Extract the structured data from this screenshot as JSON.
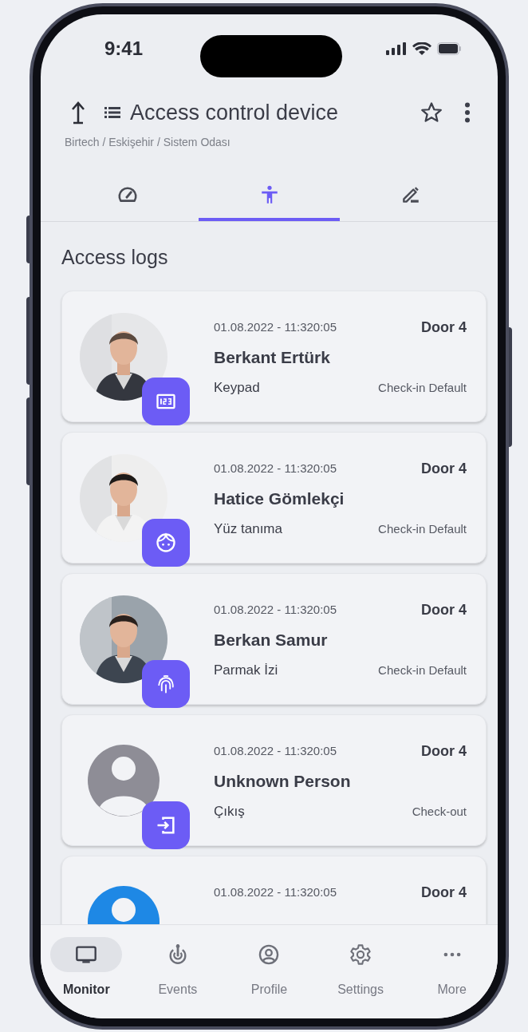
{
  "status_bar": {
    "time": "9:41"
  },
  "header": {
    "title": "Access control device",
    "breadcrumb": "Birtech / Eskişehir / Sistem Odası"
  },
  "tabs": [
    {
      "kind": "gauge",
      "selected": false
    },
    {
      "kind": "person",
      "selected": true
    },
    {
      "kind": "edit",
      "selected": false
    }
  ],
  "section_title": "Access logs",
  "logs": [
    {
      "badge": {
        "kind": "keypad"
      },
      "datetime": "01.08.2022 - 11:320:05",
      "door": "Door 4",
      "name": "Berkant Ertürk",
      "method": "Keypad",
      "type": "Check-in Default"
    },
    {
      "badge": {
        "kind": "face"
      },
      "datetime": "01.08.2022 - 11:320:05",
      "door": "Door 4",
      "name": "Hatice Gömlekçi",
      "method": "Yüz tanıma",
      "type": "Check-in Default"
    },
    {
      "badge": {
        "kind": "fingerprint"
      },
      "datetime": "01.08.2022 - 11:320:05",
      "door": "Door 4",
      "name": "Berkan Samur",
      "method": "Parmak İzi",
      "type": "Check-in Default"
    },
    {
      "avatar": {
        "kind": "placeholder",
        "color": "#8e8d96"
      },
      "badge": {
        "kind": "exit"
      },
      "datetime": "01.08.2022 - 11:320:05",
      "door": "Door 4",
      "name": "Unknown Person",
      "method": "Çıkış",
      "type": "Check-out"
    },
    {
      "avatar": {
        "kind": "placeholder",
        "color": "#1e88e5"
      },
      "datetime": "01.08.2022 - 11:320:05",
      "door": "Door 4"
    }
  ],
  "bottom_nav": [
    {
      "label": "Monitor",
      "kind": "monitor",
      "selected": true
    },
    {
      "label": "Events",
      "kind": "events",
      "selected": false
    },
    {
      "label": "Profile",
      "kind": "profile",
      "selected": false
    },
    {
      "label": "Settings",
      "kind": "settings",
      "selected": false
    },
    {
      "label": "More",
      "kind": "more",
      "selected": false
    }
  ]
}
